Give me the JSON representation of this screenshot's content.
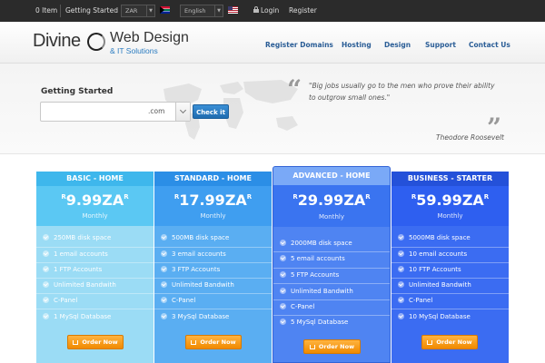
{
  "topbar": {
    "cart": "0 Item",
    "getting_started": "Getting Started",
    "currency": "ZAR",
    "language": "English",
    "login": "Login",
    "register": "Register"
  },
  "header": {
    "logo_divine": "Divine",
    "logo_web_design": "Web Design",
    "logo_it": "& IT Solutions",
    "nav": [
      "Register Domains",
      "Hosting",
      "Design",
      "Support",
      "Contact Us"
    ]
  },
  "hero": {
    "title": "Getting Started",
    "domain_value": "",
    "tld": ".com",
    "check_label": "Check it",
    "quote": "Big jobs usually go to the men who prove their ability to outgrow small ones.",
    "author": "Theodore Roosevelt"
  },
  "plans": [
    {
      "name": "BASIC - HOME",
      "currency": "R",
      "amount": "9.99ZA",
      "suffix": "R",
      "period": "Monthly",
      "features": [
        "250MB disk space",
        "1 email accounts",
        "1 FTP Accounts",
        "Unlimited Bandwith",
        "C-Panel",
        "1 MySql Database"
      ],
      "order": "Order Now"
    },
    {
      "name": "STANDARD - HOME",
      "currency": "R",
      "amount": "17.99ZA",
      "suffix": "R",
      "period": "Monthly",
      "features": [
        "500MB disk space",
        "3 email accounts",
        "3 FTP Accounts",
        "Unlimited Bandwith",
        "C-Panel",
        "3 MySql Database"
      ],
      "order": "Order Now"
    },
    {
      "name": "ADVANCED - HOME",
      "currency": "R",
      "amount": "29.99ZA",
      "suffix": "R",
      "period": "Monthly",
      "features": [
        "2000MB disk space",
        "5 email accounts",
        "5 FTP Accounts",
        "Unlimited Bandwith",
        "C-Panel",
        "5 MySql Database"
      ],
      "order": "Order Now"
    },
    {
      "name": "BUSINESS - STARTER",
      "currency": "R",
      "amount": "59.99ZA",
      "suffix": "R",
      "period": "Monthly",
      "features": [
        "5000MB disk space",
        "10 email accounts",
        "10 FTP Accounts",
        "Unlimited Bandwith",
        "C-Panel",
        "10 MySql Database"
      ],
      "order": "Order Now"
    }
  ]
}
